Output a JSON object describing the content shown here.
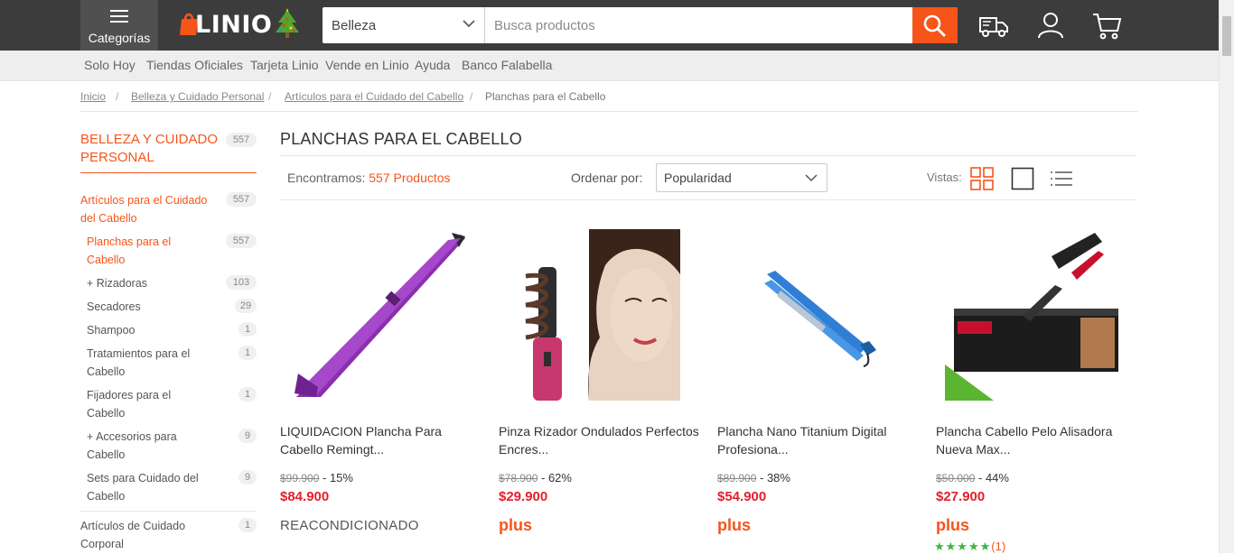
{
  "header": {
    "categories_label": "Categorías",
    "logo_text": "LINIO",
    "search": {
      "category": "Belleza",
      "placeholder": "Busca productos"
    }
  },
  "subnav": [
    "Solo Hoy",
    "Tiendas Oficiales",
    "Tarjeta Linio",
    "Vende en Linio",
    "Ayuda",
    "Banco Falabella"
  ],
  "breadcrumb": {
    "items": [
      "Inicio",
      "Belleza y Cuidado Personal",
      "Artículos para el Cuidado del Cabello",
      "Planchas para el Cabello"
    ],
    "separator": "/"
  },
  "sidebar": {
    "title": "BELLEZA Y CUIDADO PERSONAL",
    "title_count": "557",
    "items": [
      {
        "label": "Artículos para el Cuidado del Cabello",
        "count": "557"
      },
      {
        "label": "Planchas para el Cabello",
        "count": "557"
      },
      {
        "label": "+ Rizadoras",
        "count": "103"
      },
      {
        "label": "Secadores",
        "count": "29"
      },
      {
        "label": "Shampoo",
        "count": "1"
      },
      {
        "label": "Tratamientos para el Cabello",
        "count": "1"
      },
      {
        "label": "Fijadores para el Cabello",
        "count": "1"
      },
      {
        "label": "+ Accesorios para Cabello",
        "count": "9"
      },
      {
        "label": "Sets para Cuidado del Cabello",
        "count": "9"
      },
      {
        "label": "Artículos de Cuidado Corporal",
        "count": "1"
      }
    ]
  },
  "main": {
    "title": "PLANCHAS PARA EL CABELLO",
    "found_label": "Encontramos:",
    "found_count": "557 Productos",
    "sort_label": "Ordenar por:",
    "sort_value": "Popularidad",
    "views_label": "Vistas:"
  },
  "products": [
    {
      "name": "LIQUIDACION Plancha Para Cabello Remingt...",
      "old_price": "$99.900",
      "discount": "- 15%",
      "price": "$84.900",
      "tag": "REACONDICIONADO"
    },
    {
      "name": "Pinza Rizador Ondulados Perfectos Encres...",
      "old_price": "$78.900",
      "discount": "- 62%",
      "price": "$29.900",
      "tag": "plus"
    },
    {
      "name": "Plancha Nano Titanium Digital Profesiona...",
      "old_price": "$89.900",
      "discount": "- 38%",
      "price": "$54.900",
      "tag": "plus"
    },
    {
      "name": "Plancha Cabello Pelo Alisadora Nueva Max...",
      "old_price": "$50.000",
      "discount": "- 44%",
      "price": "$27.900",
      "tag": "plus",
      "stars": "★★★★★",
      "rating_count": "(1)"
    }
  ],
  "colors": {
    "accent": "#f7541a",
    "price": "#e4202c",
    "header": "#3c3c3c",
    "stars": "#3db63d"
  },
  "icons": [
    "hamburger-icon",
    "christmas-tree-icon",
    "chevron-down-icon",
    "search-icon",
    "delivery-truck-icon",
    "user-icon",
    "cart-icon",
    "grid-view-icon",
    "single-view-icon",
    "list-view-icon"
  ]
}
